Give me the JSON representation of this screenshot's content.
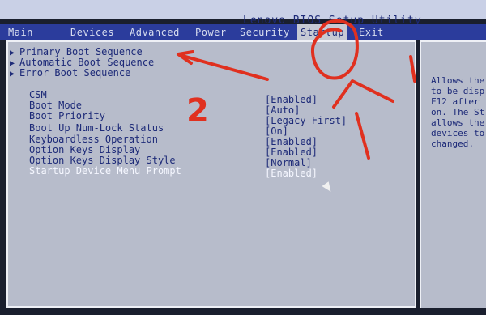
{
  "title": "Lenovo BIOS Setup Utility",
  "menu": [
    {
      "label": "Main"
    },
    {
      "label": "Devices"
    },
    {
      "label": "Advanced"
    },
    {
      "label": "Power"
    },
    {
      "label": "Security"
    },
    {
      "label": "Startup"
    },
    {
      "label": "Exit"
    }
  ],
  "submenus": [
    {
      "label": "Primary Boot Sequence"
    },
    {
      "label": "Automatic Boot Sequence"
    },
    {
      "label": "Error Boot Sequence"
    }
  ],
  "settings": [
    {
      "label": "CSM",
      "value": "[Enabled]"
    },
    {
      "label": "Boot Mode",
      "value": "[Auto]"
    },
    {
      "label": "Boot Priority",
      "value": "[Legacy First]"
    },
    {
      "label": "Boot Up Num-Lock Status",
      "value": "[On]"
    },
    {
      "label": "Keyboardless Operation",
      "value": "[Enabled]"
    },
    {
      "label": "Option Keys Display",
      "value": "[Enabled]"
    },
    {
      "label": "Option Keys Display Style",
      "value": "[Normal]"
    },
    {
      "label": "Startup Device Menu Prompt",
      "value": "[Enabled]"
    }
  ],
  "help_lines": [
    "Allows the",
    "to be disp",
    "F12 after",
    "on. The St",
    "allows the",
    "devices to",
    "changed."
  ],
  "annotations": {
    "digit": "2",
    "digit_right": "1",
    "color": "#e0301f"
  }
}
